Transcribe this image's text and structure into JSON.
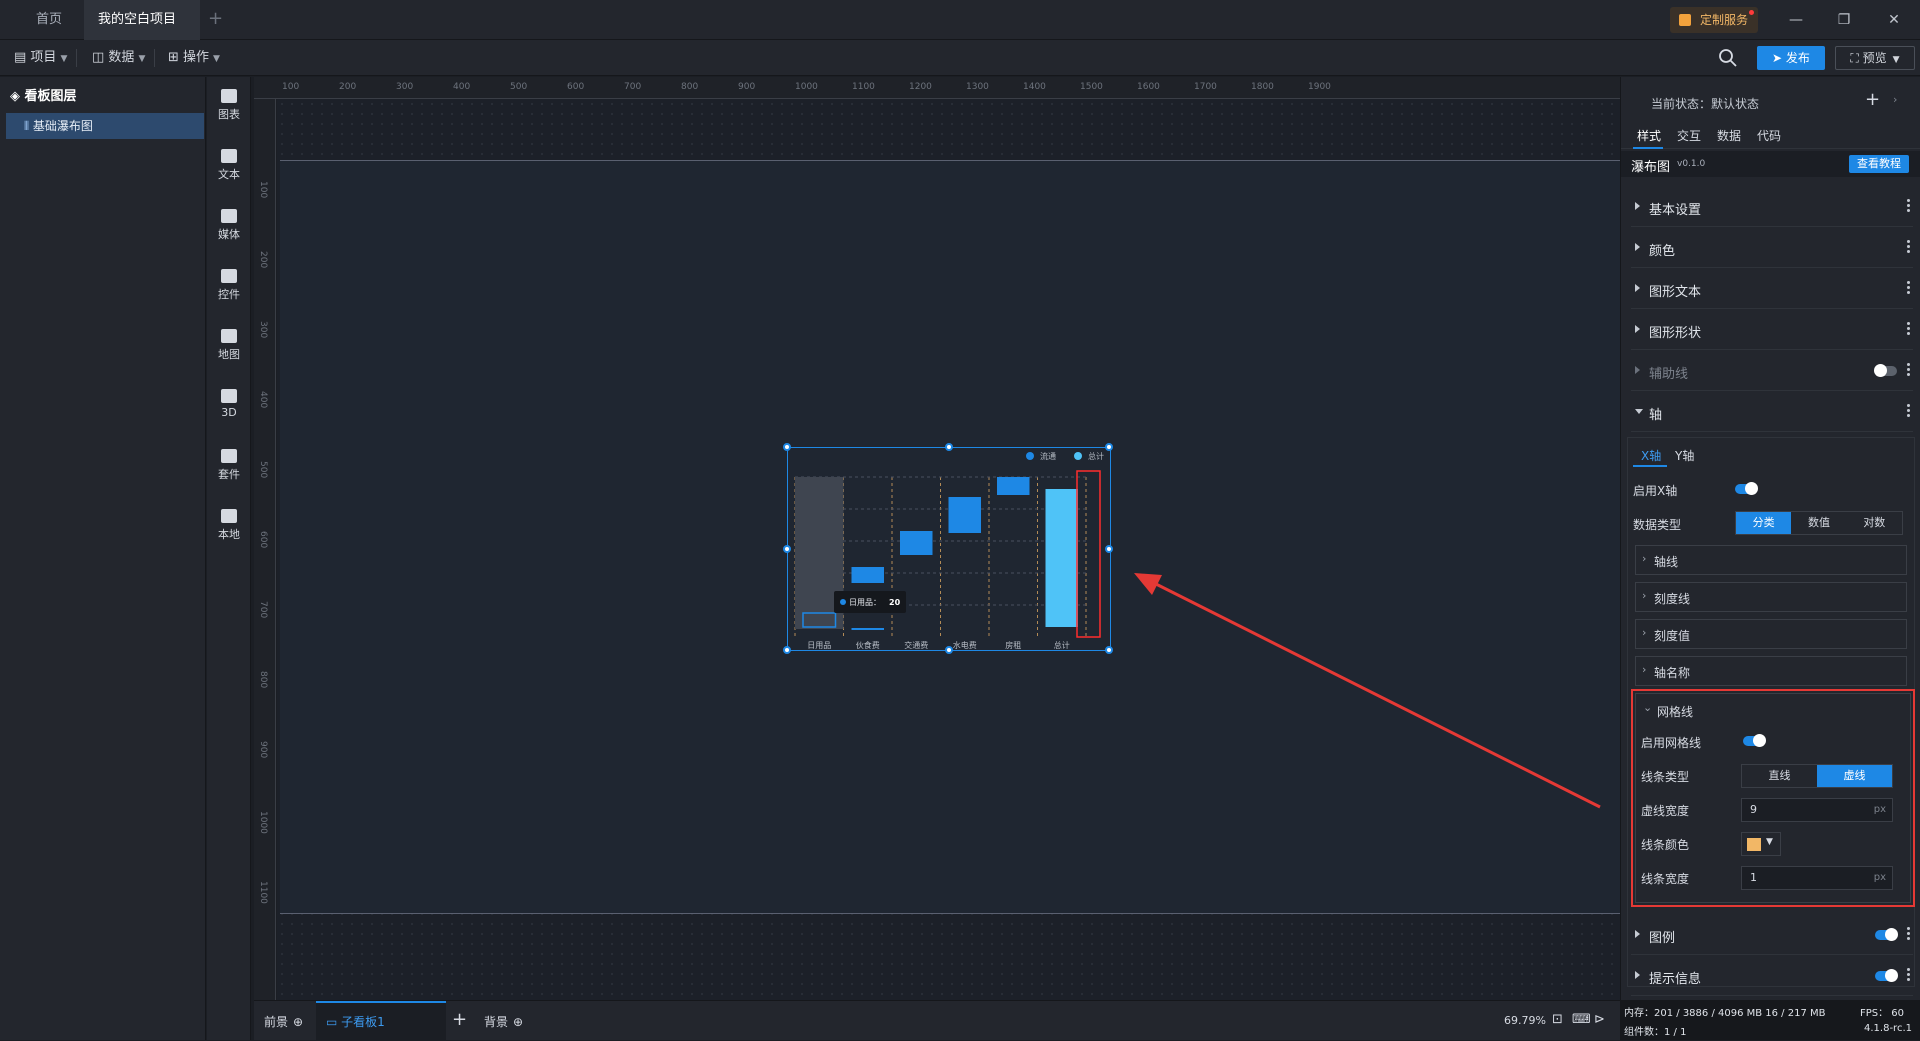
{
  "tabs": {
    "home": "首页",
    "project": "我的空白项目"
  },
  "custom_service": "定制服务",
  "toolbar": {
    "project": "项目",
    "data": "数据",
    "operate": "操作",
    "publish": "发布",
    "preview": "预览"
  },
  "layers": {
    "title": "看板图层",
    "item": "基础瀑布图"
  },
  "components": [
    "图表",
    "文本",
    "媒体",
    "控件",
    "地图",
    "3D",
    "套件",
    "本地"
  ],
  "hruler": [
    "100",
    "200",
    "300",
    "400",
    "500",
    "600",
    "700",
    "800",
    "900",
    "1000",
    "1100",
    "1200",
    "1300",
    "1400",
    "1500",
    "1600",
    "1700",
    "1800",
    "1900"
  ],
  "vruler": [
    "100",
    "200",
    "300",
    "400",
    "500",
    "600",
    "700",
    "800",
    "900",
    "1000",
    "1100"
  ],
  "chart_data": {
    "type": "bar",
    "categories": [
      "日用品",
      "伙食费",
      "交通费",
      "水电费",
      "房租",
      "总计"
    ],
    "legend": [
      "流通",
      "总计"
    ],
    "tooltip": {
      "label": "日用品：",
      "value": "20"
    },
    "colors": {
      "bar": "#1e88e5",
      "total": "#4fc3f7",
      "ghost": "#3f4550",
      "grid": "#f2b766"
    }
  },
  "bottom": {
    "foreground": "前景",
    "subboard": "子看板1",
    "background": "背景",
    "zoom": "69.79%"
  },
  "panel": {
    "state_label": "当前状态：",
    "state_value": "默认状态",
    "tabs": [
      "样式",
      "交互",
      "数据",
      "代码"
    ],
    "component_name": "瀑布图",
    "version": "v0.1.0",
    "tutorial": "查看教程",
    "sections": {
      "basic": "基本设置",
      "color": "颜色",
      "shape_text": "图形文本",
      "shape": "图形形状",
      "guide": "辅助线",
      "axis": "轴",
      "legend": "图例",
      "tooltip": "提示信息"
    },
    "axis_tabs": [
      "X轴",
      "Y轴"
    ],
    "enable_x": "启用X轴",
    "data_type": "数据类型",
    "data_type_opts": [
      "分类",
      "数值",
      "对数"
    ],
    "axis_subs": [
      "轴线",
      "刻度线",
      "刻度值",
      "轴名称"
    ],
    "grid": {
      "title": "网格线",
      "enable": "启用网格线",
      "line_type": "线条类型",
      "line_type_opts": [
        "直线",
        "虚线"
      ],
      "dash_width": "虚线宽度",
      "dash_width_value": "9",
      "line_color": "线条颜色",
      "line_color_value": "#f2b766",
      "line_width": "线条宽度",
      "line_width_value": "1",
      "unit": "px"
    }
  },
  "status": {
    "memory": "内存：201 / 3886 / 4096 MB  16 / 217 MB",
    "fps": "FPS： 60",
    "count": "组件数：1 / 1",
    "version": "4.1.8-rc.1"
  }
}
